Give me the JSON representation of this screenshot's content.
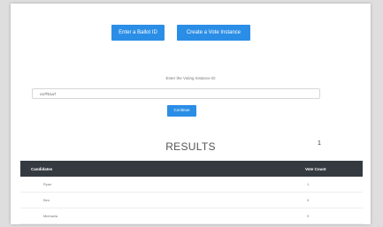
{
  "buttons": {
    "ballot": "Enter a Ballot ID",
    "vote": "Create a Vote Instance",
    "continue": "Continue"
  },
  "form": {
    "label": "Enter the Voting Instance ID",
    "input_value": "ca7f61a7"
  },
  "results": {
    "title": "RESULTS",
    "mark": "1",
    "columns": [
      "Candidates",
      "Vote Count"
    ],
    "rows": [
      {
        "candidate": "Ryan",
        "votes": "1"
      },
      {
        "candidate": "Ben",
        "votes": "0"
      },
      {
        "candidate": "Michaela",
        "votes": "0"
      }
    ]
  }
}
